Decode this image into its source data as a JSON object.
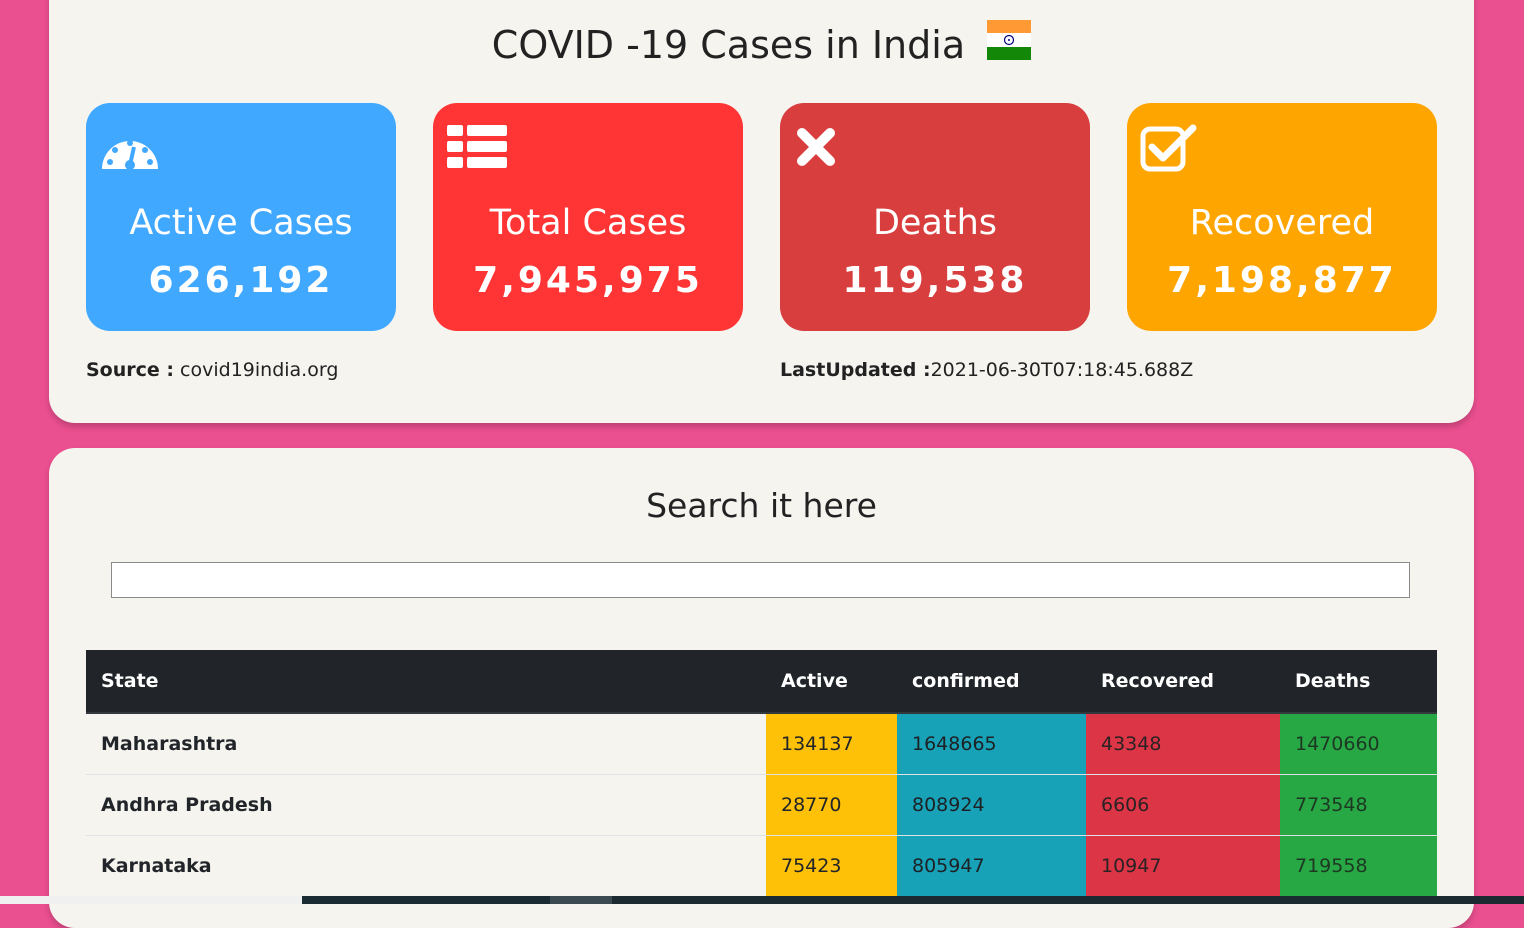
{
  "header": {
    "title": "COVID -19 Cases in India",
    "flag_icon": "india-flag-icon"
  },
  "stats": [
    {
      "label": "Active Cases",
      "value": "626,192",
      "icon": "dashboard-gauge-icon",
      "color": "#41a8ff"
    },
    {
      "label": "Total Cases",
      "value": "7,945,975",
      "icon": "list-icon",
      "color": "#ff3535"
    },
    {
      "label": "Deaths",
      "value": "119,538",
      "icon": "close-icon",
      "color": "#d83e3e"
    },
    {
      "label": "Recovered",
      "value": "7,198,877",
      "icon": "check-square-icon",
      "color": "#ffa500"
    }
  ],
  "meta": {
    "source_label": "Source :",
    "source_value": "covid19india.org",
    "updated_label": "LastUpdated :",
    "updated_value": "2021-06-30T07:18:45.688Z"
  },
  "search": {
    "title": "Search it here",
    "value": "",
    "placeholder": ""
  },
  "table": {
    "headers": [
      "State",
      "Active",
      "confirmed",
      "Recovered",
      "Deaths"
    ],
    "rows": [
      [
        "Maharashtra",
        "134137",
        "1648665",
        "43348",
        "1470660"
      ],
      [
        "Andhra Pradesh",
        "28770",
        "808924",
        "6606",
        "773548"
      ],
      [
        "Karnataka",
        "75423",
        "805947",
        "10947",
        "719558"
      ]
    ]
  }
}
